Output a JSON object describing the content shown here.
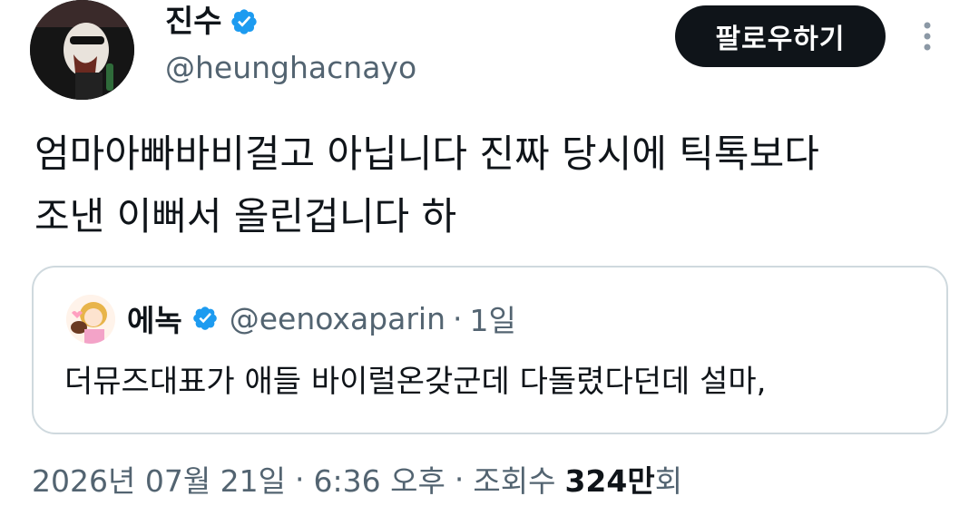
{
  "author": {
    "display_name": "진수",
    "handle": "@heunghacnayo",
    "verified": true,
    "avatar_icon": "sunglasses-figure-avatar"
  },
  "follow_button": {
    "label": "팔로우하기"
  },
  "more_menu": {
    "icon": "vertical-dots-icon"
  },
  "tweet": {
    "lines": [
      "엄마아빠바비걸고 아닙니다 진짜 당시에 틱톡보다",
      "조낸 이뻐서 올린겁니다 하"
    ]
  },
  "quoted_tweet": {
    "display_name": "에녹",
    "handle": "@eenoxaparin",
    "dot": "·",
    "time": "1일",
    "verified": true,
    "text": "더뮤즈대표가 애들 바이럴온갖군데 다돌렸다던데 설마,"
  },
  "meta": {
    "date": "2026년 07월 21일",
    "time": "6:36 오후",
    "views_label": "조회수",
    "views_count": "324만",
    "views_unit": "회",
    "separator": "·"
  },
  "colors": {
    "verified_blue": "#1d9bf0",
    "text_primary": "#0f1419",
    "text_secondary": "#536471",
    "border": "#cfd9de",
    "button_bg": "#0f1419"
  }
}
